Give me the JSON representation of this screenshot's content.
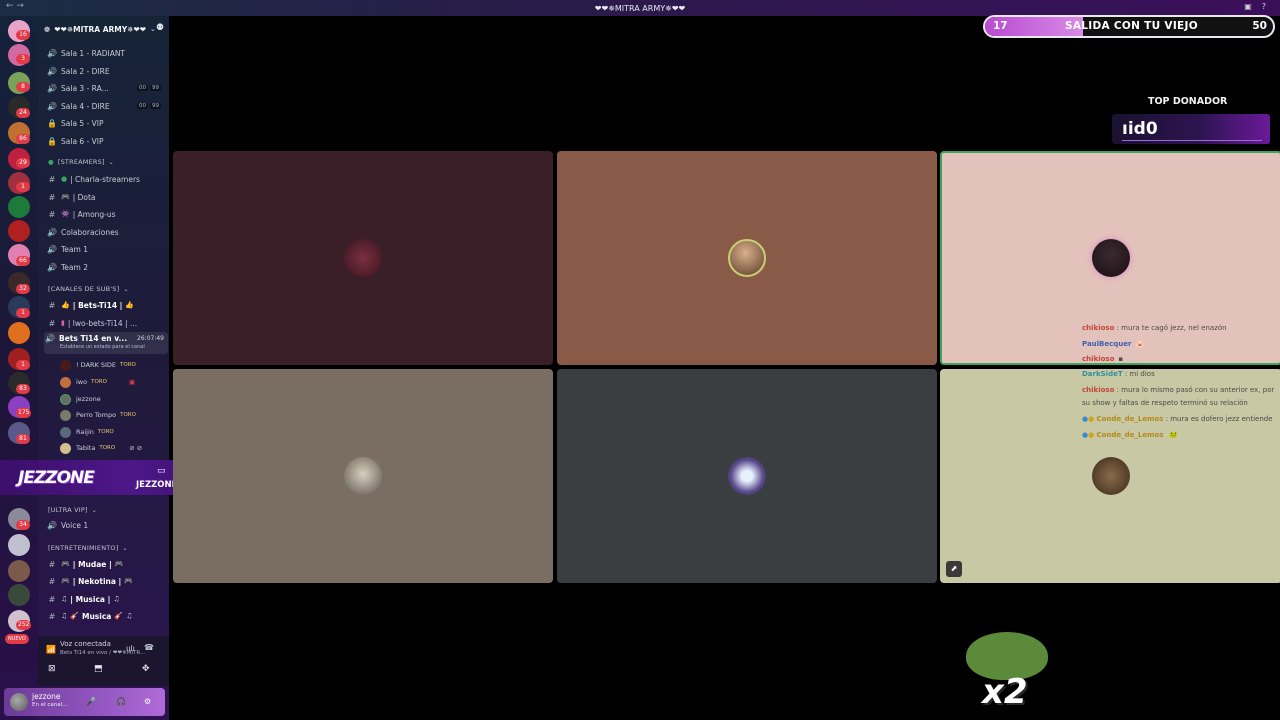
{
  "window": {
    "title": "❤❤✵MITRA ARMY✵❤❤"
  },
  "server": {
    "name": "❤❤✵MITRA ARMY✵❤❤"
  },
  "rail_badges": [
    "16",
    "3",
    "8",
    "24",
    "86",
    "29",
    "1",
    "66",
    "32",
    "1",
    "1",
    "83",
    "175",
    "81",
    "34",
    "252"
  ],
  "rail_new": "NUEVO",
  "channels_top": [
    {
      "label": "Sala 1 - RADIANT",
      "icon": "speaker-icon"
    },
    {
      "label": "Sala 2 - DIRE",
      "icon": "speaker-icon"
    },
    {
      "label": "Sala 3 - RA...",
      "icon": "speaker-icon",
      "a": "00",
      "b": "99"
    },
    {
      "label": "Sala 4 - DIRE",
      "icon": "speaker-icon",
      "a": "00",
      "b": "99"
    },
    {
      "label": "Sala 5 - VIP",
      "icon": "lock-icon"
    },
    {
      "label": "Sala 6 - VIP",
      "icon": "lock-icon"
    }
  ],
  "cat_streamers": "[STREAMERS]",
  "channels_streamers": [
    {
      "label": "| Charla-streamers",
      "icon": "hash-icon"
    },
    {
      "label": "| Dota",
      "icon": "hash-icon"
    },
    {
      "label": "| Among-us",
      "icon": "hash-icon"
    },
    {
      "label": "Colaboraciones",
      "icon": "speaker-icon"
    },
    {
      "label": "Team 1",
      "icon": "speaker-icon"
    },
    {
      "label": "Team 2",
      "icon": "speaker-icon"
    }
  ],
  "cat_subs": "[CANALES DE SUB'S]",
  "channels_subs": [
    {
      "label": "| Bets-Ti14 |",
      "icon": "hash-icon"
    },
    {
      "label": "| lwo-bets-Ti14 | ...",
      "icon": "hash-icon"
    }
  ],
  "active_channel": {
    "label": "Bets Ti14 en v...",
    "time": "26:07:49",
    "sub": "Establece un estado para el canal"
  },
  "voice_users": [
    {
      "name": "! DARK SIDE",
      "tag": "TORO"
    },
    {
      "name": "iwo",
      "tag": "TORO"
    },
    {
      "name": "jezzone",
      "tag": ""
    },
    {
      "name": "Perro Tompo",
      "tag": "TORO"
    },
    {
      "name": "Raijin",
      "tag": "TORO"
    },
    {
      "name": "Tabita",
      "tag": "TORO"
    }
  ],
  "banner": {
    "logo": "JEZZONE",
    "handle": "JEZZONE_"
  },
  "cat_vip": "[ULTRA VIP]",
  "channels_vip": [
    {
      "label": "Voice 1",
      "icon": "speaker-icon"
    }
  ],
  "cat_ent": "[ENTRETENIMIENTO]",
  "channels_ent": [
    {
      "label": "| Mudae |",
      "icon": "hash-icon"
    },
    {
      "label": "| Nekotina |",
      "icon": "hash-icon"
    },
    {
      "label": "| Musica |",
      "icon": "hash-icon"
    },
    {
      "label": "Musica",
      "icon": "hash-icon"
    }
  ],
  "voice_status": {
    "title": "Voz conectada",
    "sub": "Bets Ti14 en vivo / ❤❤✵MITR..."
  },
  "user": {
    "name": "jezzone",
    "status": "En el canal..."
  },
  "goal": {
    "current": "17",
    "label": "SALIDA CON TU VIEJO",
    "max": "50",
    "progress": 0.34
  },
  "top_donor": {
    "title": "TOP DONADOR",
    "name": "ıid0"
  },
  "chat": [
    {
      "user": "chikioso",
      "text": " : mura te cagó jezz, nel enazón",
      "color": "#c2453a"
    },
    {
      "user": "PaulBecquer",
      "text": "",
      "color": "#3f5fb0"
    },
    {
      "user": "chikioso",
      "text": "",
      "color": "#c2453a"
    },
    {
      "user": "DarkSideT",
      "text": " : mi dios",
      "color": "#2f8fa0"
    },
    {
      "user": "chikioso",
      "text": " : mura lo mismo pasó con su anterior ex, por su show y faltas de respeto terminó su relación",
      "color": "#c2453a"
    },
    {
      "user": "Conde_de_Lemos",
      "text": " : mura es dofero jezz entiende",
      "color": "#b58a1a"
    },
    {
      "user": "Conde_de_Lemos",
      "text": "",
      "color": "#b58a1a"
    }
  ],
  "pepe": {
    "label": "x2"
  }
}
